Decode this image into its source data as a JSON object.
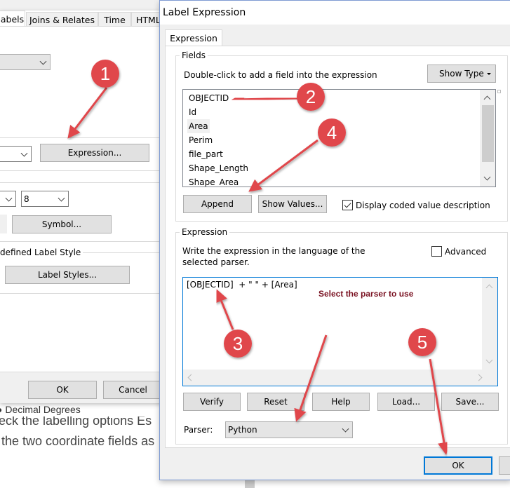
{
  "layer_properties": {
    "tabs": [
      "abels",
      "Joins & Relates",
      "Time",
      "HTML"
    ],
    "expression_button": "Expression...",
    "size_value": "8",
    "symbol_button": "Symbol...",
    "label_style_group": "defined Label Style",
    "label_styles_button": "Label Styles...",
    "ok": "OK",
    "cancel": "Cancel"
  },
  "background_page": {
    "line1": "Decimal Degrees",
    "line2": "eck the labelling options Es",
    "line3": "the two coordinate fields as"
  },
  "dialog": {
    "title": "Label Expression",
    "tab": "Expression",
    "fields": {
      "group_label": "Fields",
      "instruction": "Double-click to add a field into the expression",
      "show_type": "Show Type",
      "items": [
        "OBJECTID",
        "Id",
        "Area",
        "Perim",
        "file_part",
        "Shape_Length",
        "Shape_Area"
      ],
      "selected": "Area",
      "append": "Append",
      "show_values": "Show Values...",
      "display_coded": "Display coded value description",
      "display_coded_checked": true
    },
    "expression": {
      "group_label": "Expression",
      "instruction": "Write the expression in the language of the selected parser.",
      "advanced": "Advanced",
      "advanced_checked": false,
      "value": "[OBJECTID]  + \" \" + [Area]",
      "buttons": [
        "Verify",
        "Reset",
        "Help",
        "Load...",
        "Save..."
      ],
      "parser_label": "Parser:",
      "parser_value": "Python"
    },
    "ok": "OK"
  },
  "annotations": {
    "note": "Select the parser to use",
    "steps": [
      "1",
      "2",
      "3",
      "4",
      "5"
    ],
    "color": "#e0474c"
  }
}
